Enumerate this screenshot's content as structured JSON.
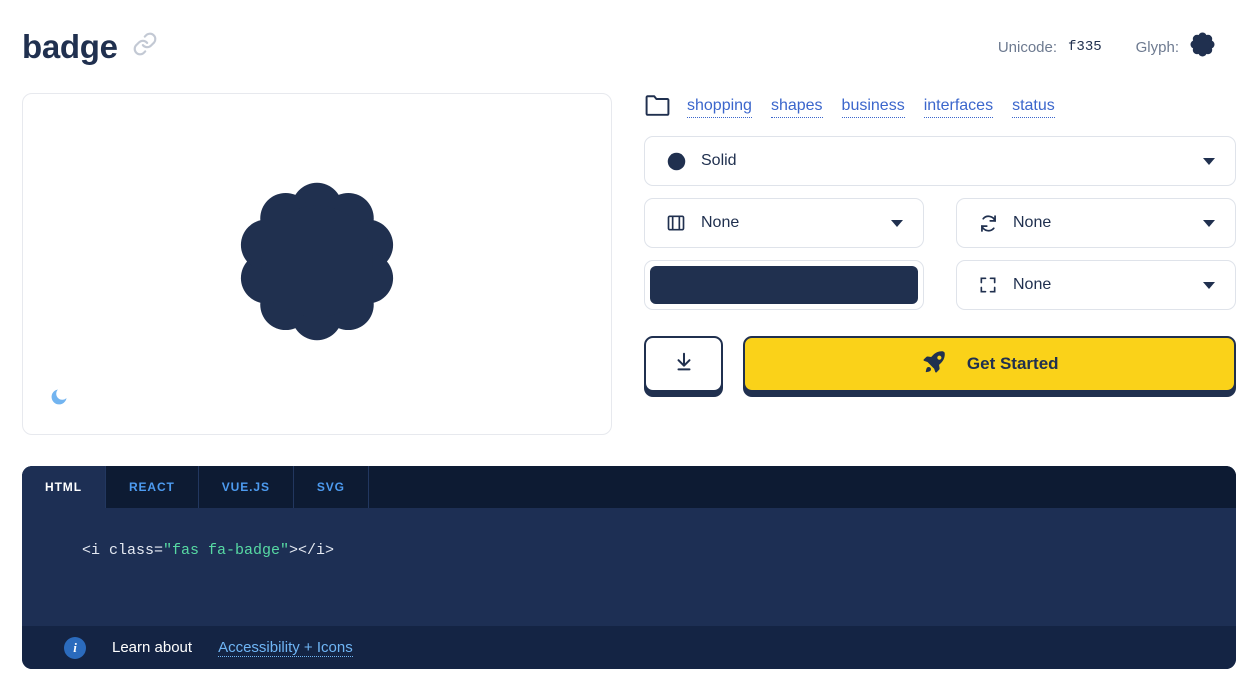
{
  "header": {
    "title": "badge",
    "link_icon": "link-icon",
    "unicode_label": "Unicode:",
    "unicode_value": "f335",
    "glyph_label": "Glyph:",
    "glyph_icon": "badge-glyph-icon"
  },
  "preview": {
    "icon_name": "badge-icon",
    "theme_toggle_icon": "moon-icon"
  },
  "categories": {
    "folder_icon": "folder-icon",
    "items": [
      {
        "label": "shopping"
      },
      {
        "label": "shapes"
      },
      {
        "label": "business"
      },
      {
        "label": "interfaces"
      },
      {
        "label": "status"
      }
    ]
  },
  "controls": {
    "style": {
      "icon": "circle-solid-icon",
      "value": "Solid"
    },
    "animation": {
      "icon": "film-icon",
      "value": "None"
    },
    "rotate": {
      "icon": "rotate-icon",
      "value": "None"
    },
    "color": {
      "icon": "color-swatch",
      "value": "#20304f"
    },
    "size": {
      "icon": "expand-icon",
      "value": "None"
    }
  },
  "actions": {
    "download": {
      "icon": "download-icon",
      "label": ""
    },
    "get_started": {
      "icon": "rocket-icon",
      "label": "Get Started"
    }
  },
  "code": {
    "tabs": [
      {
        "label": "HTML",
        "active": true
      },
      {
        "label": "REACT",
        "active": false
      },
      {
        "label": "VUE.JS",
        "active": false
      },
      {
        "label": "SVG",
        "active": false
      }
    ],
    "snippet_pre": "<i class=",
    "snippet_str": "\"fas fa-badge\"",
    "snippet_post": "></i>",
    "footer": {
      "info_icon": "info-icon",
      "text": "Learn about",
      "link": "Accessibility + Icons"
    }
  },
  "colors": {
    "navy": "#20304f",
    "yellow": "#fad219",
    "link_blue": "#3b66cc",
    "moon_blue": "#72b4f0",
    "code_bg": "#1d2f54"
  }
}
